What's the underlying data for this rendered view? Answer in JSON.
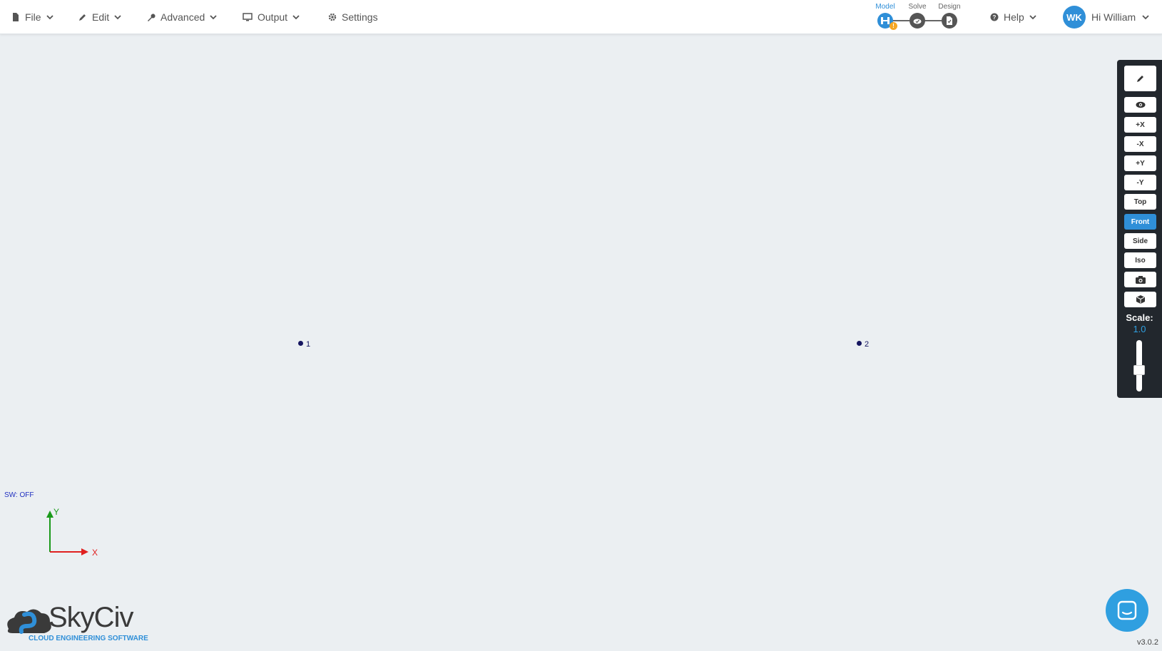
{
  "menu": {
    "file": "File",
    "edit": "Edit",
    "advanced": "Advanced",
    "output": "Output",
    "settings": "Settings"
  },
  "steps": {
    "model": "Model",
    "solve": "Solve",
    "design": "Design",
    "warning_badge": "!"
  },
  "help": "Help",
  "user": {
    "initials": "WK",
    "greeting": "Hi William"
  },
  "toolbar": {
    "plus_x": "+X",
    "minus_x": "-X",
    "plus_y": "+Y",
    "minus_y": "-Y",
    "top": "Top",
    "front": "Front",
    "side": "Side",
    "iso": "Iso",
    "scale_label": "Scale:",
    "scale_value": "1.0"
  },
  "canvas": {
    "nodes": [
      "1",
      "2"
    ],
    "sw_status": "SW: OFF",
    "axis_y": "Y",
    "axis_x": "X"
  },
  "brand": {
    "name": "SkyCiv",
    "tagline": "CLOUD ENGINEERING SOFTWARE"
  },
  "version": "v3.0.2",
  "colors": {
    "accent": "#2f8fd8",
    "canvas_bg": "#ebeff2",
    "toolbar_bg": "#22272d",
    "node": "#151560",
    "warning": "#f5a623"
  }
}
